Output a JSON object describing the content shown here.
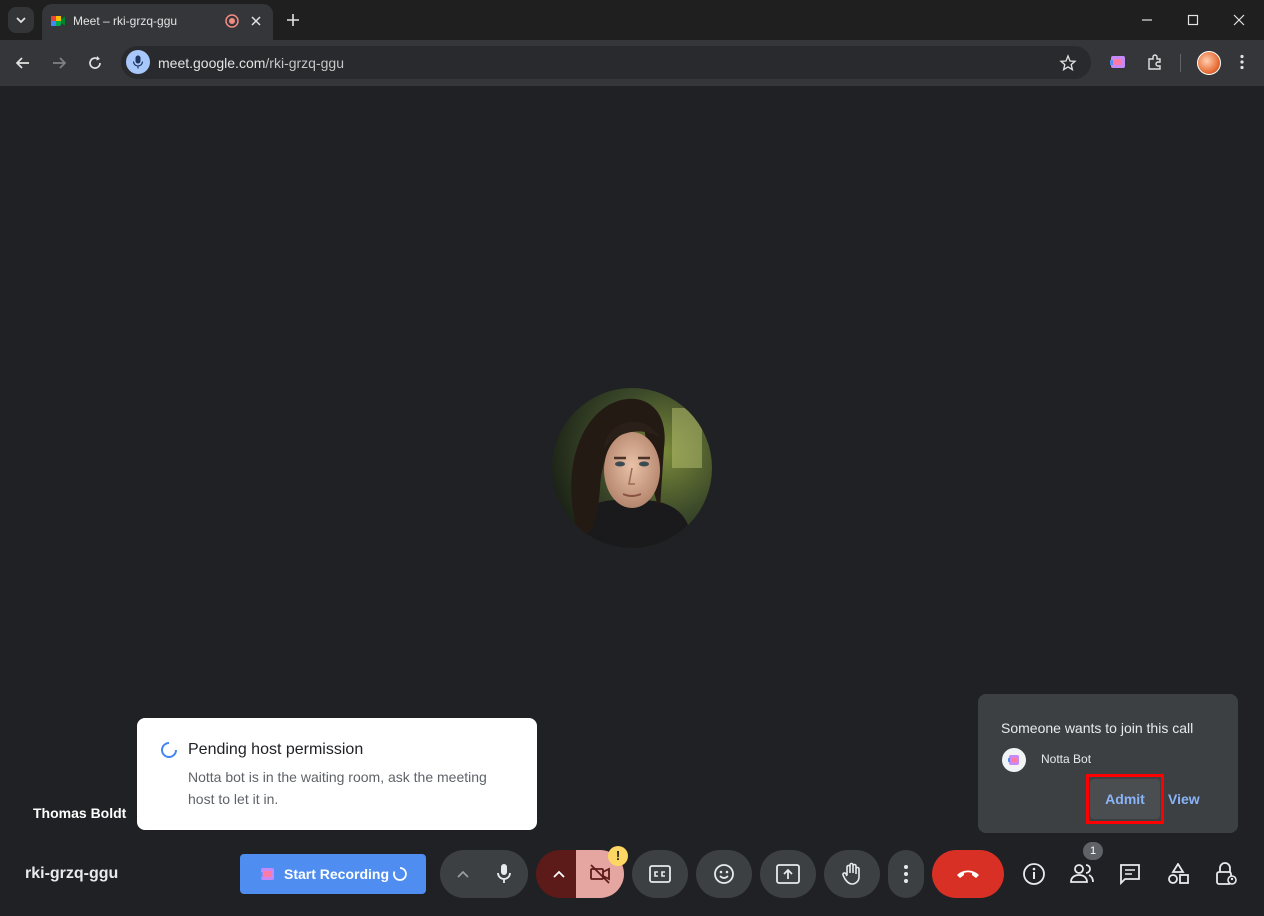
{
  "browser": {
    "tab": {
      "title": "Meet – rki-grzq-ggu"
    },
    "address": {
      "host": "meet.google.com",
      "path": "/rki-grzq-ggu"
    },
    "icons": [
      "tab-search-icon",
      "meet-favicon",
      "recording-indicator-icon",
      "close-icon",
      "new-tab-icon",
      "minimize-icon",
      "maximize-icon",
      "window-close-icon",
      "back-icon",
      "forward-icon",
      "reload-icon",
      "mic-icon",
      "bookmark-star-icon",
      "notta-extension-icon",
      "extensions-puzzle-icon",
      "more-vert-icon"
    ]
  },
  "meet": {
    "participant": {
      "name": "Thomas Boldt"
    },
    "pending_toast": {
      "title": "Pending host permission",
      "body": "Notta bot is in the waiting room, ask the meeting host to let it in."
    },
    "join_request": {
      "title": "Someone wants to join this call",
      "requester": "Notta Bot",
      "admit_label": "Admit",
      "view_label": "View"
    },
    "meeting_code": "rki-grzq-ggu",
    "recording": {
      "label": "Start Recording"
    },
    "people_count": "1",
    "camera_warning": "!",
    "colors": {
      "end_call": "#d93025",
      "accent": "#8ab4f8",
      "record_button": "#4f8ef0",
      "highlight": "#ff0000"
    }
  }
}
